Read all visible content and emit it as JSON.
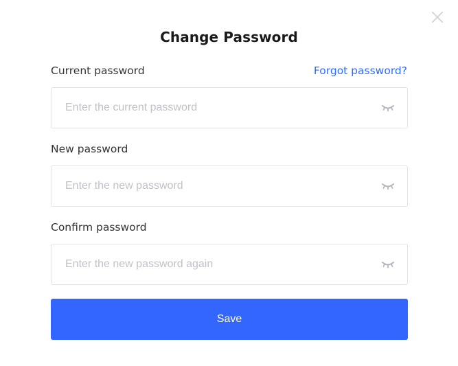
{
  "dialog": {
    "title": "Change Password",
    "close_icon": "close-icon"
  },
  "form": {
    "current_password": {
      "label": "Current password",
      "placeholder": "Enter the current password",
      "value": "",
      "toggle_icon": "eye-closed-icon"
    },
    "forgot_link": "Forgot password?",
    "new_password": {
      "label": "New password",
      "placeholder": "Enter the new password",
      "value": "",
      "toggle_icon": "eye-closed-icon"
    },
    "confirm_password": {
      "label": "Confirm password",
      "placeholder": "Enter the new password again",
      "value": "",
      "toggle_icon": "eye-closed-icon"
    },
    "save_label": "Save"
  },
  "colors": {
    "accent": "#3366ff",
    "link": "#2f6bff",
    "border": "#e1e3e8",
    "placeholder": "#bfc2c8",
    "title": "#1a1a1a"
  }
}
